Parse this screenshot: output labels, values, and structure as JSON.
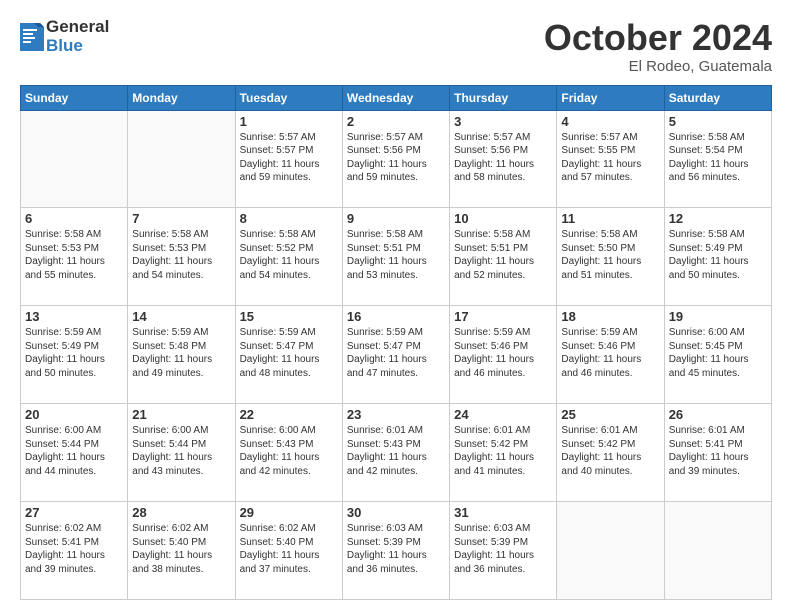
{
  "header": {
    "logo_general": "General",
    "logo_blue": "Blue",
    "month_title": "October 2024",
    "location": "El Rodeo, Guatemala"
  },
  "weekdays": [
    "Sunday",
    "Monday",
    "Tuesday",
    "Wednesday",
    "Thursday",
    "Friday",
    "Saturday"
  ],
  "weeks": [
    [
      {
        "day": "",
        "info": ""
      },
      {
        "day": "",
        "info": ""
      },
      {
        "day": "1",
        "info": "Sunrise: 5:57 AM\nSunset: 5:57 PM\nDaylight: 11 hours and 59 minutes."
      },
      {
        "day": "2",
        "info": "Sunrise: 5:57 AM\nSunset: 5:56 PM\nDaylight: 11 hours and 59 minutes."
      },
      {
        "day": "3",
        "info": "Sunrise: 5:57 AM\nSunset: 5:56 PM\nDaylight: 11 hours and 58 minutes."
      },
      {
        "day": "4",
        "info": "Sunrise: 5:57 AM\nSunset: 5:55 PM\nDaylight: 11 hours and 57 minutes."
      },
      {
        "day": "5",
        "info": "Sunrise: 5:58 AM\nSunset: 5:54 PM\nDaylight: 11 hours and 56 minutes."
      }
    ],
    [
      {
        "day": "6",
        "info": "Sunrise: 5:58 AM\nSunset: 5:53 PM\nDaylight: 11 hours and 55 minutes."
      },
      {
        "day": "7",
        "info": "Sunrise: 5:58 AM\nSunset: 5:53 PM\nDaylight: 11 hours and 54 minutes."
      },
      {
        "day": "8",
        "info": "Sunrise: 5:58 AM\nSunset: 5:52 PM\nDaylight: 11 hours and 54 minutes."
      },
      {
        "day": "9",
        "info": "Sunrise: 5:58 AM\nSunset: 5:51 PM\nDaylight: 11 hours and 53 minutes."
      },
      {
        "day": "10",
        "info": "Sunrise: 5:58 AM\nSunset: 5:51 PM\nDaylight: 11 hours and 52 minutes."
      },
      {
        "day": "11",
        "info": "Sunrise: 5:58 AM\nSunset: 5:50 PM\nDaylight: 11 hours and 51 minutes."
      },
      {
        "day": "12",
        "info": "Sunrise: 5:58 AM\nSunset: 5:49 PM\nDaylight: 11 hours and 50 minutes."
      }
    ],
    [
      {
        "day": "13",
        "info": "Sunrise: 5:59 AM\nSunset: 5:49 PM\nDaylight: 11 hours and 50 minutes."
      },
      {
        "day": "14",
        "info": "Sunrise: 5:59 AM\nSunset: 5:48 PM\nDaylight: 11 hours and 49 minutes."
      },
      {
        "day": "15",
        "info": "Sunrise: 5:59 AM\nSunset: 5:47 PM\nDaylight: 11 hours and 48 minutes."
      },
      {
        "day": "16",
        "info": "Sunrise: 5:59 AM\nSunset: 5:47 PM\nDaylight: 11 hours and 47 minutes."
      },
      {
        "day": "17",
        "info": "Sunrise: 5:59 AM\nSunset: 5:46 PM\nDaylight: 11 hours and 46 minutes."
      },
      {
        "day": "18",
        "info": "Sunrise: 5:59 AM\nSunset: 5:46 PM\nDaylight: 11 hours and 46 minutes."
      },
      {
        "day": "19",
        "info": "Sunrise: 6:00 AM\nSunset: 5:45 PM\nDaylight: 11 hours and 45 minutes."
      }
    ],
    [
      {
        "day": "20",
        "info": "Sunrise: 6:00 AM\nSunset: 5:44 PM\nDaylight: 11 hours and 44 minutes."
      },
      {
        "day": "21",
        "info": "Sunrise: 6:00 AM\nSunset: 5:44 PM\nDaylight: 11 hours and 43 minutes."
      },
      {
        "day": "22",
        "info": "Sunrise: 6:00 AM\nSunset: 5:43 PM\nDaylight: 11 hours and 42 minutes."
      },
      {
        "day": "23",
        "info": "Sunrise: 6:01 AM\nSunset: 5:43 PM\nDaylight: 11 hours and 42 minutes."
      },
      {
        "day": "24",
        "info": "Sunrise: 6:01 AM\nSunset: 5:42 PM\nDaylight: 11 hours and 41 minutes."
      },
      {
        "day": "25",
        "info": "Sunrise: 6:01 AM\nSunset: 5:42 PM\nDaylight: 11 hours and 40 minutes."
      },
      {
        "day": "26",
        "info": "Sunrise: 6:01 AM\nSunset: 5:41 PM\nDaylight: 11 hours and 39 minutes."
      }
    ],
    [
      {
        "day": "27",
        "info": "Sunrise: 6:02 AM\nSunset: 5:41 PM\nDaylight: 11 hours and 39 minutes."
      },
      {
        "day": "28",
        "info": "Sunrise: 6:02 AM\nSunset: 5:40 PM\nDaylight: 11 hours and 38 minutes."
      },
      {
        "day": "29",
        "info": "Sunrise: 6:02 AM\nSunset: 5:40 PM\nDaylight: 11 hours and 37 minutes."
      },
      {
        "day": "30",
        "info": "Sunrise: 6:03 AM\nSunset: 5:39 PM\nDaylight: 11 hours and 36 minutes."
      },
      {
        "day": "31",
        "info": "Sunrise: 6:03 AM\nSunset: 5:39 PM\nDaylight: 11 hours and 36 minutes."
      },
      {
        "day": "",
        "info": ""
      },
      {
        "day": "",
        "info": ""
      }
    ]
  ]
}
